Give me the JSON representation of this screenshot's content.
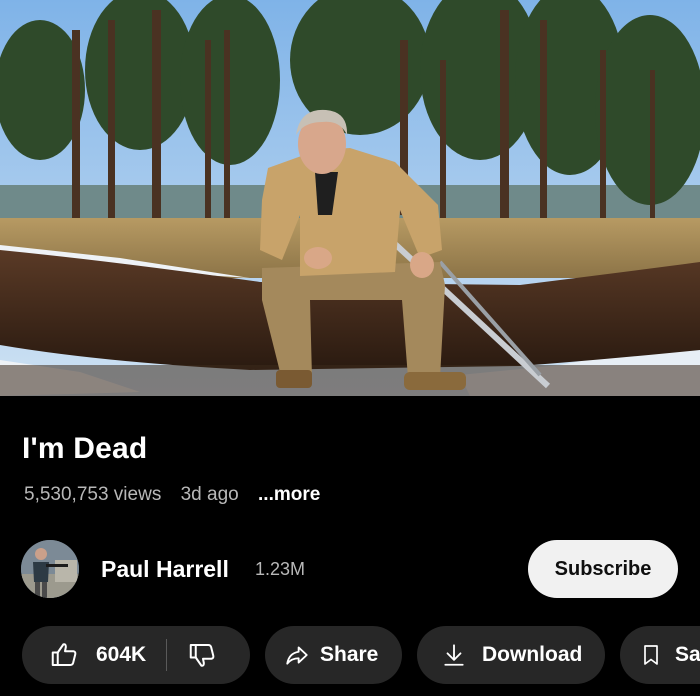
{
  "video": {
    "title": "I'm Dead",
    "views": "5,530,753 views",
    "age": "3d ago",
    "more_label": "...more"
  },
  "channel": {
    "name": "Paul Harrell",
    "subscribers": "1.23M",
    "subscribe_label": "Subscribe"
  },
  "actions": {
    "like_count": "604K",
    "share_label": "Share",
    "download_label": "Download",
    "save_label": "Save"
  },
  "icons": {
    "like": "thumbs-up-icon",
    "dislike": "thumbs-down-icon",
    "share": "share-arrow-icon",
    "download": "download-icon",
    "save": "bookmark-icon"
  },
  "colors": {
    "background": "#000000",
    "pill": "#272727",
    "subscribe_bg": "#f1f1f1",
    "secondary_text": "#b8b8b8"
  }
}
